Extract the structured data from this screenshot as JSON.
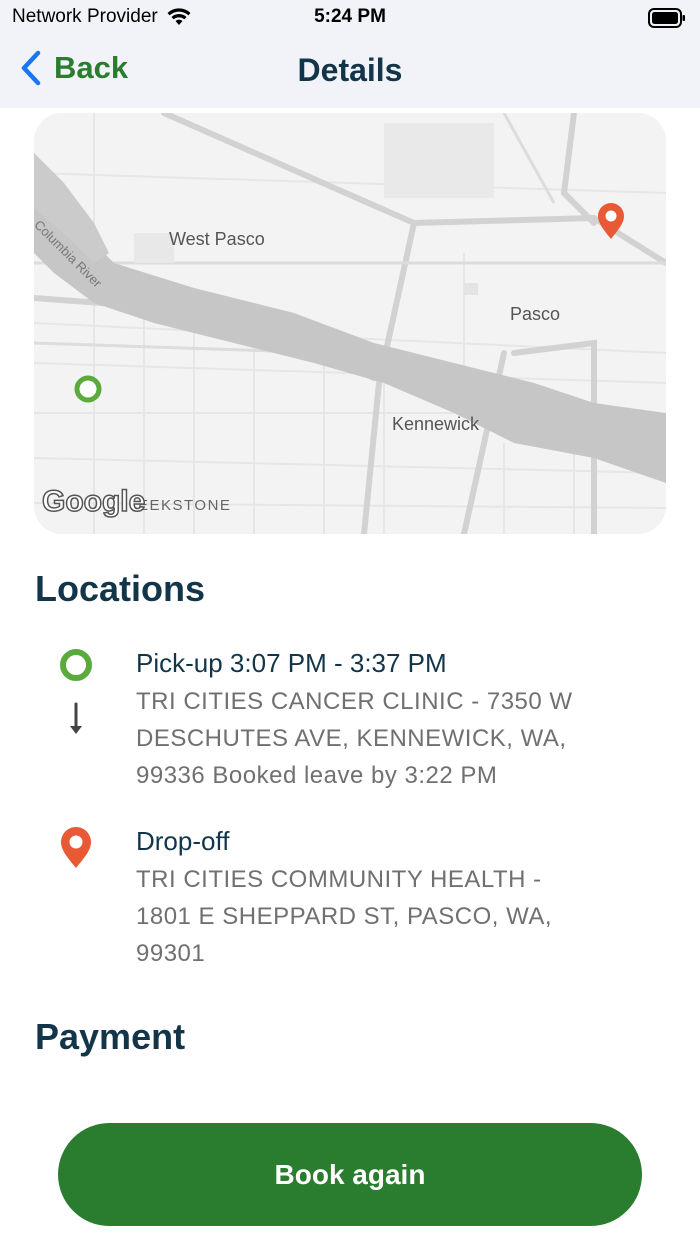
{
  "status_bar": {
    "carrier": "Network Provider",
    "time": "5:24 PM"
  },
  "nav": {
    "back_label": "Back",
    "title": "Details"
  },
  "map": {
    "labels": {
      "west_pasco": "West Pasco",
      "pasco": "Pasco",
      "kennewick": "Kennewick",
      "columbia_river": "Columbia River",
      "partial": "EEKSTONE",
      "google": "Google"
    },
    "pickup_color": "#5aaa3c",
    "dropoff_color": "#e85a35"
  },
  "locations": {
    "title": "Locations",
    "pickup": {
      "title": "Pick-up 3:07 PM - 3:37 PM",
      "address_lines": [
        "TRI CITIES CANCER CLINIC - 7350 W",
        "DESCHUTES AVE, KENNEWICK, WA,",
        "99336 Booked leave by 3:22 PM"
      ]
    },
    "dropoff": {
      "title": "Drop-off",
      "address_lines": [
        "TRI CITIES COMMUNITY HEALTH -",
        "1801 E SHEPPARD ST, PASCO, WA,",
        "99301"
      ]
    }
  },
  "payment": {
    "title": "Payment"
  },
  "actions": {
    "book_again": "Book again"
  },
  "colors": {
    "accent_green": "#2a7d2e",
    "heading": "#13354a",
    "body_text": "#707070"
  }
}
